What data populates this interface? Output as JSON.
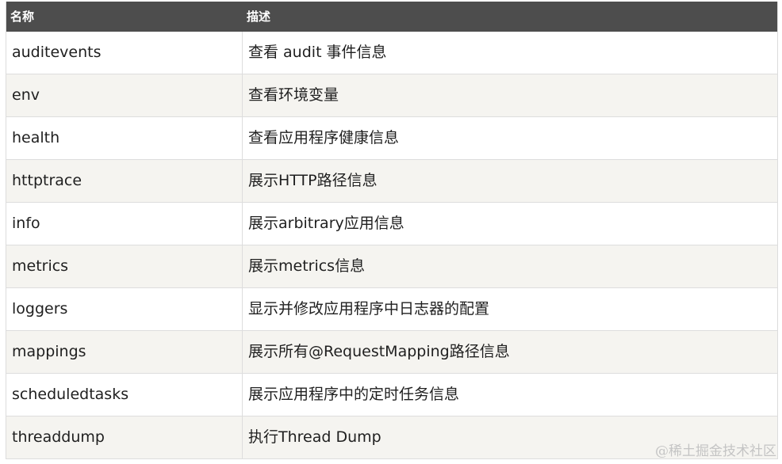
{
  "table": {
    "headers": [
      "名称",
      "描述"
    ],
    "rows": [
      {
        "name": "auditevents",
        "desc": "查看 audit 事件信息"
      },
      {
        "name": "env",
        "desc": "查看环境变量"
      },
      {
        "name": "health",
        "desc": "查看应用程序健康信息"
      },
      {
        "name": "httptrace",
        "desc": "展示HTTP路径信息"
      },
      {
        "name": "info",
        "desc": "展示arbitrary应用信息"
      },
      {
        "name": "metrics",
        "desc": "展示metrics信息"
      },
      {
        "name": "loggers",
        "desc": "显示并修改应用程序中日志器的配置"
      },
      {
        "name": "mappings",
        "desc": "展示所有@RequestMapping路径信息"
      },
      {
        "name": "scheduledtasks",
        "desc": "展示应用程序中的定时任务信息"
      },
      {
        "name": "threaddump",
        "desc": "执行Thread Dump"
      }
    ]
  },
  "watermark": "@稀土掘金技术社区"
}
